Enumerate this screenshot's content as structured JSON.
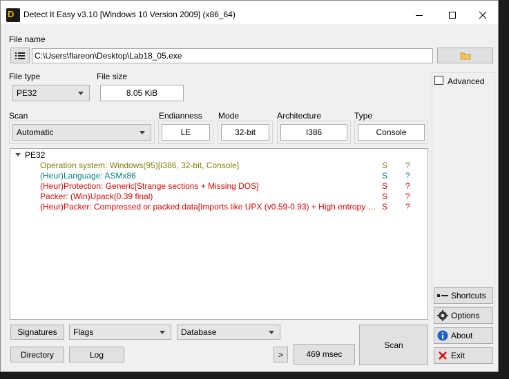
{
  "window": {
    "title": "Detect It Easy v3.10 [Windows 10 Version 2009] (x86_64)"
  },
  "file": {
    "label": "File name",
    "path": "C:\\Users\\flareon\\Desktop\\Lab18_05.exe"
  },
  "file_type": {
    "label": "File type",
    "value": "PE32"
  },
  "file_size": {
    "label": "File size",
    "value": "8.05 KiB"
  },
  "scan": {
    "label": "Scan",
    "value": "Automatic"
  },
  "endianness": {
    "label": "Endianness",
    "value": "LE"
  },
  "mode": {
    "label": "Mode",
    "value": "32-bit"
  },
  "architecture": {
    "label": "Architecture",
    "value": "I386"
  },
  "type": {
    "label": "Type",
    "value": "Console"
  },
  "advanced": {
    "label": "Advanced",
    "checked": false
  },
  "results": {
    "root": "PE32",
    "rows": [
      {
        "text": "Operation system: Windows(95)[I386, 32-bit, Console]",
        "s": "S",
        "q": "?",
        "color": "#808000"
      },
      {
        "text": "(Heur)Language: ASMx86",
        "s": "S",
        "q": "?",
        "color": "#008080"
      },
      {
        "text": "(Heur)Protection: Generic[Strange sections + Missing DOS]",
        "s": "S",
        "q": "?",
        "color": "#e00000"
      },
      {
        "text": "Packer: (Win)Upack(0.39 final)",
        "s": "S",
        "q": "?",
        "color": "#e00000"
      },
      {
        "text": "(Heur)Packer: Compressed or packed data[Imports like UPX (v0.59-0.93) + High entropy + ...",
        "s": "S",
        "q": "?",
        "color": "#e00000"
      }
    ]
  },
  "bottom": {
    "signatures": "Signatures",
    "flags": "Flags",
    "database": "Database",
    "directory": "Directory",
    "log": "Log",
    "more": ">",
    "time": "469 msec",
    "scan": "Scan"
  },
  "side": {
    "shortcuts": "Shortcuts",
    "options": "Options",
    "about": "About",
    "exit": "Exit"
  },
  "colors": {
    "olive": "#808000",
    "teal": "#008080",
    "red": "#e00000"
  }
}
